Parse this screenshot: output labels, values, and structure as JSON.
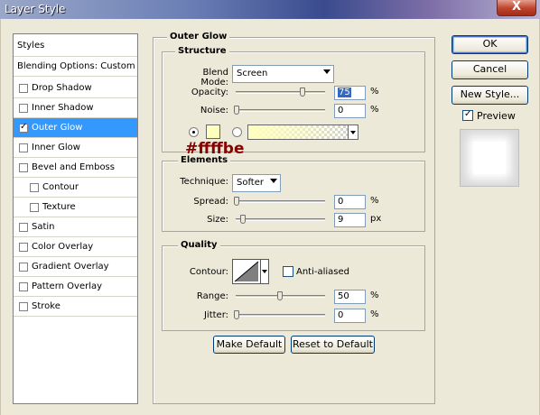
{
  "window": {
    "title": "Layer Style",
    "close_glyph": "X"
  },
  "styles_list": {
    "header": "Styles",
    "blending": "Blending Options: Custom",
    "items": [
      {
        "label": "Drop Shadow",
        "checked": false
      },
      {
        "label": "Inner Shadow",
        "checked": false
      },
      {
        "label": "Outer Glow",
        "checked": true
      },
      {
        "label": "Inner Glow",
        "checked": false
      },
      {
        "label": "Bevel and Emboss",
        "checked": false
      },
      {
        "label": "Contour",
        "checked": false
      },
      {
        "label": "Texture",
        "checked": false
      },
      {
        "label": "Satin",
        "checked": false
      },
      {
        "label": "Color Overlay",
        "checked": false
      },
      {
        "label": "Gradient Overlay",
        "checked": false
      },
      {
        "label": "Pattern Overlay",
        "checked": false
      },
      {
        "label": "Stroke",
        "checked": false
      }
    ]
  },
  "outer_glow": {
    "title": "Outer Glow",
    "structure": {
      "title": "Structure",
      "blend_mode_label": "Blend Mode:",
      "blend_mode_value": "Screen",
      "opacity_label": "Opacity:",
      "opacity_value": "75",
      "opacity_unit": "%",
      "noise_label": "Noise:",
      "noise_value": "0",
      "noise_unit": "%",
      "glow_color": "#ffffbe",
      "color_annotation": "#ffffbe"
    },
    "elements": {
      "title": "Elements",
      "technique_label": "Technique:",
      "technique_value": "Softer",
      "spread_label": "Spread:",
      "spread_value": "0",
      "spread_unit": "%",
      "size_label": "Size:",
      "size_value": "9",
      "size_unit": "px"
    },
    "quality": {
      "title": "Quality",
      "contour_label": "Contour:",
      "anti_aliased_label": "Anti-aliased",
      "range_label": "Range:",
      "range_value": "50",
      "range_unit": "%",
      "jitter_label": "Jitter:",
      "jitter_value": "0",
      "jitter_unit": "%"
    },
    "make_default": "Make Default",
    "reset_default": "Reset to Default"
  },
  "actions": {
    "ok": "OK",
    "cancel": "Cancel",
    "new_style": "New Style...",
    "preview": "Preview"
  }
}
